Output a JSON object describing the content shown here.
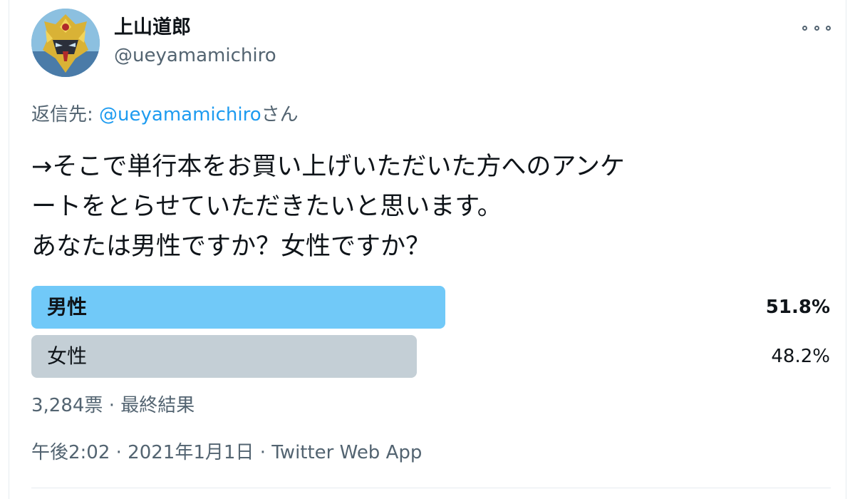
{
  "user": {
    "display_name": "上山道郎",
    "handle": "@ueyamamichiro"
  },
  "more_icon": "more-horizontal-icon",
  "reply_to": {
    "prefix": "返信先: ",
    "mention": "@ueyamamichiro",
    "suffix": "さん"
  },
  "tweet": {
    "lines": [
      "→そこで単行本をお買い上げいただいた方へのアンケ",
      "ートをとらせていただきたいと思います。",
      "あなたは男性ですか？女性ですか？"
    ]
  },
  "poll": {
    "options": [
      {
        "label": "男性",
        "percent_text": "51.8%",
        "percent": 51.8,
        "winner": true,
        "color": "#71c9f8"
      },
      {
        "label": "女性",
        "percent_text": "48.2%",
        "percent": 48.2,
        "winner": false,
        "color": "#c4cfd6"
      }
    ],
    "meta": "3,284票 · 最終結果"
  },
  "timestamp": "午後2:02 · 2021年1月1日 · Twitter Web App",
  "colors": {
    "accent": "#1d9bf0",
    "secondary_text": "#536471"
  }
}
